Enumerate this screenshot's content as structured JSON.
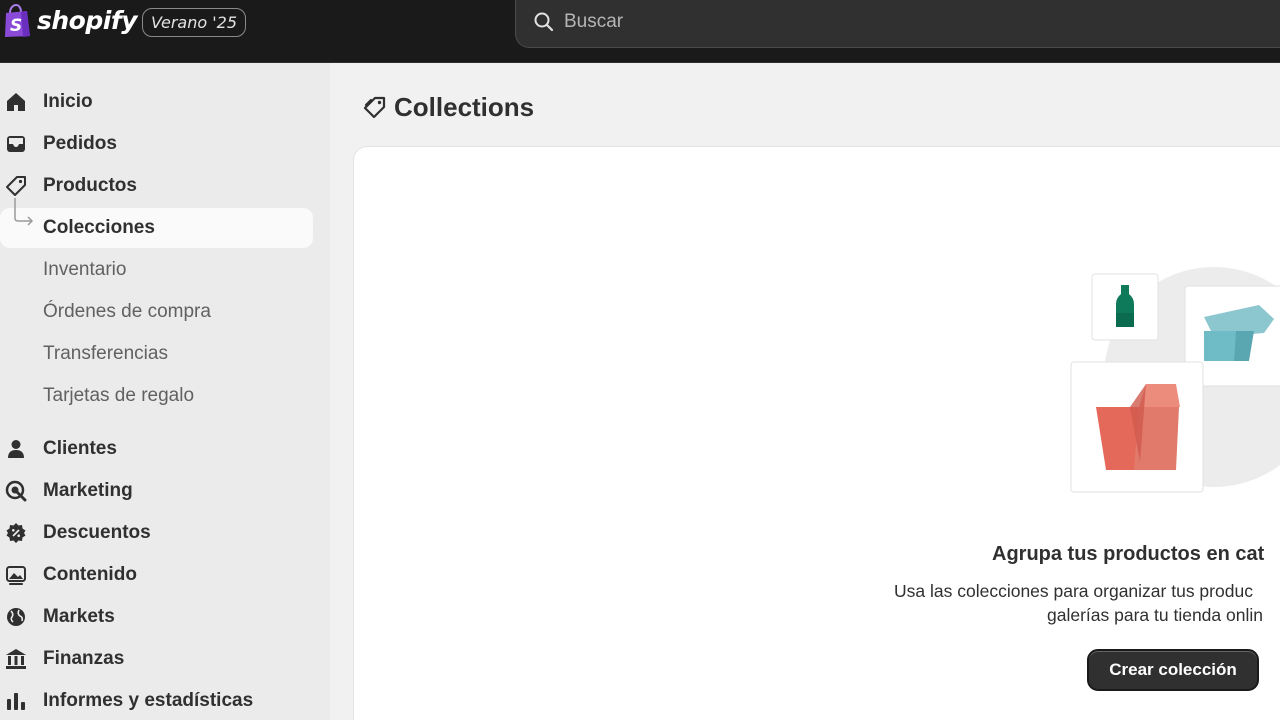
{
  "brand": {
    "name": "shopify",
    "edition": "Verano '25",
    "bag_color": "#8a4ad8"
  },
  "search": {
    "placeholder": "Buscar"
  },
  "sidebar": {
    "items": [
      {
        "label": "Inicio",
        "icon": "home-icon"
      },
      {
        "label": "Pedidos",
        "icon": "inbox-icon"
      },
      {
        "label": "Productos",
        "icon": "tag-icon"
      },
      {
        "label": "Colecciones",
        "active": true
      },
      {
        "label": "Inventario"
      },
      {
        "label": "Órdenes de compra"
      },
      {
        "label": "Transferencias"
      },
      {
        "label": "Tarjetas de regalo"
      },
      {
        "label": "Clientes",
        "icon": "person-icon"
      },
      {
        "label": "Marketing",
        "icon": "target-icon"
      },
      {
        "label": "Descuentos",
        "icon": "discount-icon"
      },
      {
        "label": "Contenido",
        "icon": "image-icon"
      },
      {
        "label": "Markets",
        "icon": "globe-icon"
      },
      {
        "label": "Finanzas",
        "icon": "bank-icon"
      },
      {
        "label": "Informes y estadísticas",
        "icon": "bar-chart-icon"
      }
    ]
  },
  "page": {
    "title": "Collections"
  },
  "empty_state": {
    "heading": "Agrupa tus productos en cat",
    "description_line1": "Usa las colecciones para organizar tus produc",
    "description_line2": "galerías para tu tienda onlin",
    "button_label": "Crear colección"
  },
  "colors": {
    "topbar": "#1a1a1a",
    "sidebar": "#ebebeb",
    "accent_dark": "#303030",
    "illus_green": "#0f7a5a",
    "illus_teal": "#6fbcc6",
    "illus_red": "#e5695a"
  }
}
